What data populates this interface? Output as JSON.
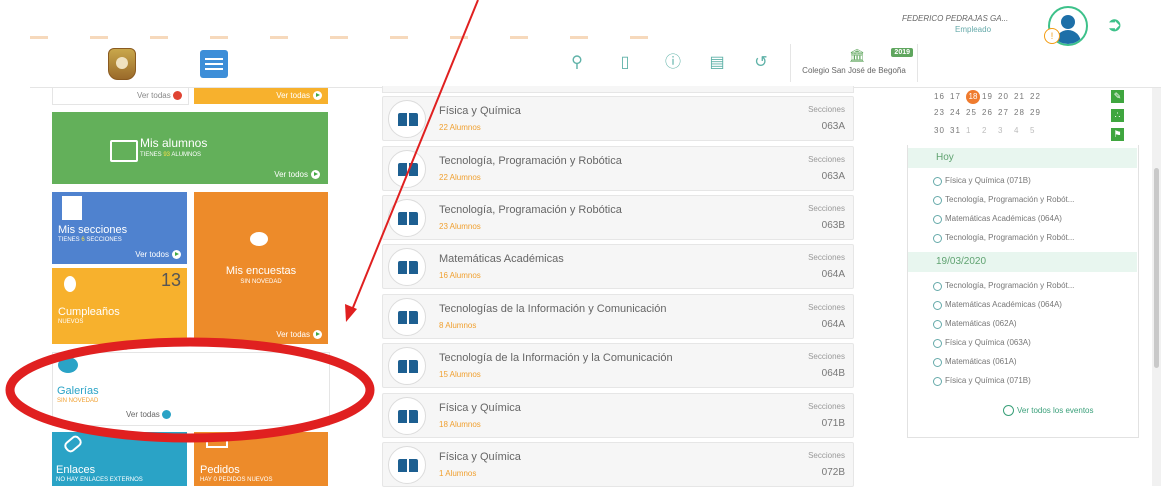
{
  "topbar": {
    "school_name": "Colegio San José de Begoña",
    "year": "2019",
    "user_name": "FEDERICO PEDRAJAS GA...",
    "user_role": "Empleado",
    "user_badge": "!"
  },
  "tiles": {
    "top_left_link": "Ver todas",
    "top_right_link": "Ver todas",
    "alumnos": {
      "label": "Mis alumnos",
      "sub_pre": "TIENES",
      "count": "93",
      "sub_post": "ALUMNOS",
      "link": "Ver todos"
    },
    "secciones": {
      "label": "Mis secciones",
      "sub_pre": "TIENES",
      "count": "6",
      "sub_post": "SECCIONES",
      "link": "Ver todos"
    },
    "encuestas": {
      "label": "Mis encuestas",
      "sub": "SIN NOVEDAD",
      "link": "Ver todas"
    },
    "cumple": {
      "label": "Cumpleaños",
      "sub": "NUEVOS",
      "count": "13"
    },
    "galerias": {
      "label": "Galerías",
      "sub": "SIN NOVEDAD",
      "link": "Ver todas"
    },
    "enlaces": {
      "label": "Enlaces",
      "sub": "NO HAY ENLACES EXTERNOS"
    },
    "pedidos": {
      "label": "Pedidos",
      "sub": "HAY 0 PEDIDOS NUEVOS"
    }
  },
  "subjects": [
    {
      "name": "Física y Química",
      "alumnos": "22 Alumnos",
      "sec_label": "Secciones",
      "code": "063A"
    },
    {
      "name": "Tecnología, Programación y Robótica",
      "alumnos": "22 Alumnos",
      "sec_label": "Secciones",
      "code": "063A"
    },
    {
      "name": "Tecnología, Programación y Robótica",
      "alumnos": "23 Alumnos",
      "sec_label": "Secciones",
      "code": "063B"
    },
    {
      "name": "Matemáticas Académicas",
      "alumnos": "16 Alumnos",
      "sec_label": "Secciones",
      "code": "064A"
    },
    {
      "name": "Tecnologías de la Información y Comunicación",
      "alumnos": "8 Alumnos",
      "sec_label": "Secciones",
      "code": "064A"
    },
    {
      "name": "Tecnología de la Información y la Comunicación",
      "alumnos": "15 Alumnos",
      "sec_label": "Secciones",
      "code": "064B"
    },
    {
      "name": "Física y Química",
      "alumnos": "18 Alumnos",
      "sec_label": "Secciones",
      "code": "071B"
    },
    {
      "name": "Física y Química",
      "alumnos": "1 Alumnos",
      "sec_label": "Secciones",
      "code": "072B"
    }
  ],
  "calendar": {
    "row1": [
      "16",
      "17",
      "18",
      "19",
      "20",
      "21",
      "22"
    ],
    "row2": [
      "23",
      "24",
      "25",
      "26",
      "27",
      "28",
      "29"
    ],
    "row3": [
      "30",
      "31",
      "1",
      "2",
      "3",
      "4",
      "5"
    ]
  },
  "events": {
    "today_label": "Hoy",
    "today": [
      "Física y Química (071B)",
      "Tecnología, Programación y Robót...",
      "Matemáticas Académicas (064A)",
      "Tecnología, Programación y Robót..."
    ],
    "date_label": "19/03/2020",
    "date_events": [
      "Tecnología, Programación y Robót...",
      "Matemáticas Académicas (064A)",
      "Matemáticas (062A)",
      "Física y Química (063A)",
      "Matemáticas (061A)",
      "Física y Química (071B)"
    ],
    "see_all": "Ver todos los eventos"
  },
  "colors": {
    "green": "#63b05a",
    "blue": "#4f82cf",
    "orange": "#ed8b2a",
    "yellow": "#f7b12d",
    "teal": "#2aa3c6",
    "annotation_red": "#e02020"
  }
}
